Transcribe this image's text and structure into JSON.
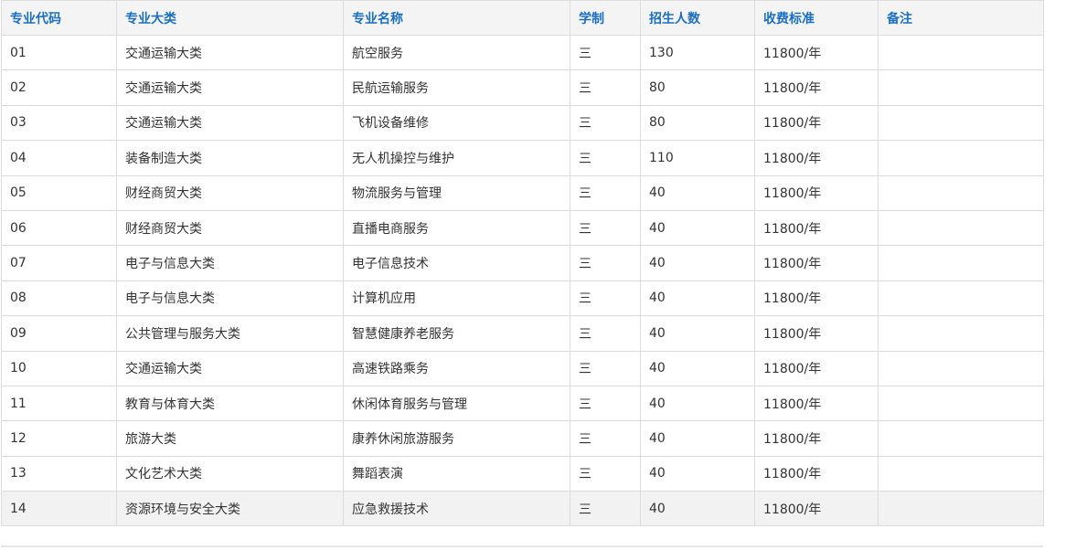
{
  "table": {
    "headers": [
      "专业代码",
      "专业大类",
      "专业名称",
      "学制",
      "招生人数",
      "收费标准",
      "备注"
    ],
    "rows": [
      [
        "01",
        "交通运输大类",
        "航空服务",
        "三",
        "130",
        "11800/年",
        ""
      ],
      [
        "02",
        "交通运输大类",
        "民航运输服务",
        "三",
        "80",
        "11800/年",
        ""
      ],
      [
        "03",
        "交通运输大类",
        "飞机设备维修",
        "三",
        "80",
        "11800/年",
        ""
      ],
      [
        "04",
        "装备制造大类",
        "无人机操控与维护",
        "三",
        "110",
        "11800/年",
        ""
      ],
      [
        "05",
        "财经商贸大类",
        "物流服务与管理",
        "三",
        "40",
        "11800/年",
        ""
      ],
      [
        "06",
        "财经商贸大类",
        "直播电商服务",
        "三",
        "40",
        "11800/年",
        ""
      ],
      [
        "07",
        "电子与信息大类",
        "电子信息技术",
        "三",
        "40",
        "11800/年",
        ""
      ],
      [
        "08",
        "电子与信息大类",
        "计算机应用",
        "三",
        "40",
        "11800/年",
        ""
      ],
      [
        "09",
        "公共管理与服务大类",
        "智慧健康养老服务",
        "三",
        "40",
        "11800/年",
        ""
      ],
      [
        "10",
        "交通运输大类",
        "高速铁路乘务",
        "三",
        "40",
        "11800/年",
        ""
      ],
      [
        "11",
        "教育与体育大类",
        "休闲体育服务与管理",
        "三",
        "40",
        "11800/年",
        ""
      ],
      [
        "12",
        "旅游大类",
        "康养休闲旅游服务",
        "三",
        "40",
        "11800/年",
        ""
      ],
      [
        "13",
        "文化艺术大类",
        "舞蹈表演",
        "三",
        "40",
        "11800/年",
        ""
      ],
      [
        "14",
        "资源环境与安全大类",
        "应急救援技术",
        "三",
        "40",
        "11800/年",
        ""
      ]
    ]
  },
  "colors": {
    "header_text": "#1a6fc4",
    "header_bg": "#f4f4f4",
    "border": "#dcdcdc",
    "body_text": "#333333",
    "last_row_bg": "#f2f2f2"
  }
}
